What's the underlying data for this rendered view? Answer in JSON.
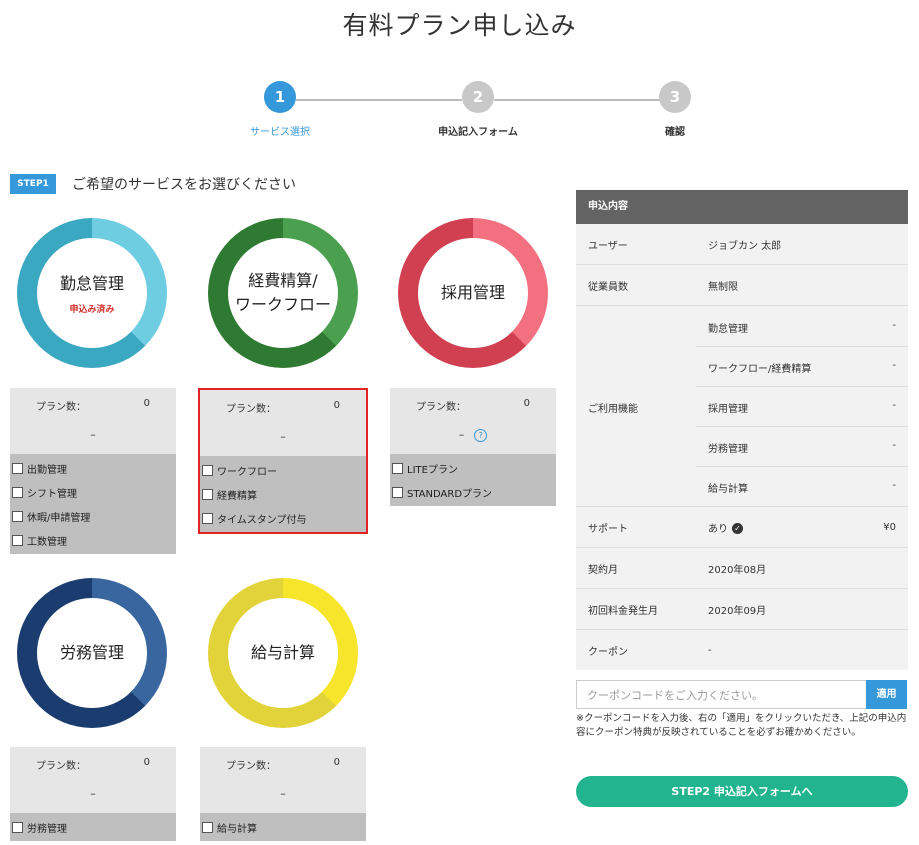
{
  "page_title": "有料プラン申し込み",
  "stepper": [
    {
      "num": "1",
      "label": "サービス選択",
      "active": true
    },
    {
      "num": "2",
      "label": "申込記入フォーム",
      "active": false
    },
    {
      "num": "3",
      "label": "確認",
      "active": false
    }
  ],
  "step1": {
    "badge": "STEP1",
    "heading": "ご希望のサービスをお選びください"
  },
  "services": [
    {
      "name_line1": "勤怠管理",
      "name_line2": "",
      "sub": "申込み済み",
      "color_main": "#3aa8c1",
      "color_light": "#6fcde2",
      "plan_label": "プラン数：",
      "plan_count": "0",
      "dash": "–",
      "items": [
        "出勤管理",
        "シフト管理",
        "休暇/申請管理",
        "工数管理"
      ]
    },
    {
      "name_line1": "経費精算/",
      "name_line2": "ワークフロー",
      "sub": "",
      "color_main": "#2f7a32",
      "color_light": "#4aa04e",
      "plan_label": "プラン数：",
      "plan_count": "0",
      "dash": "–",
      "items": [
        "ワークフロー",
        "経費精算",
        "タイムスタンプ付与"
      ]
    },
    {
      "name_line1": "採用管理",
      "name_line2": "",
      "sub": "",
      "color_main": "#d04050",
      "color_light": "#f27080",
      "plan_label": "プラン数：",
      "plan_count": "0",
      "dash": "–",
      "help_icon": "?",
      "items": [
        "LITEプラン",
        "STANDARDプラン"
      ]
    },
    {
      "name_line1": "労務管理",
      "name_line2": "",
      "sub": "",
      "color_main": "#1a3c6e",
      "color_light": "#3a66a0",
      "plan_label": "プラン数：",
      "plan_count": "0",
      "dash": "–",
      "items": [
        "労務管理"
      ]
    },
    {
      "name_line1": "給与計算",
      "name_line2": "",
      "sub": "",
      "color_main": "#e2d33a",
      "color_light": "#f6e52a",
      "plan_label": "プラン数：",
      "plan_count": "0",
      "dash": "–",
      "items": [
        "給与計算"
      ]
    }
  ],
  "summary": {
    "header": "申込内容",
    "user_key": "ユーザー",
    "user_val": "ジョブカン 太郎",
    "emp_key": "従業員数",
    "emp_val": "無制限",
    "features_key": "ご利用機能",
    "features": [
      {
        "name": "勤怠管理",
        "val": "-"
      },
      {
        "name": "ワークフロー/経費精算",
        "val": "-"
      },
      {
        "name": "採用管理",
        "val": "-"
      },
      {
        "name": "労務管理",
        "val": "-"
      },
      {
        "name": "給与計算",
        "val": "-"
      }
    ],
    "support_key": "サポート",
    "support_val": "あり",
    "support_price": "¥0",
    "contract_key": "契約月",
    "contract_val": "2020年08月",
    "first_fee_key": "初回料金発生月",
    "first_fee_val": "2020年09月",
    "coupon_key": "クーポン",
    "coupon_val": "-"
  },
  "coupon": {
    "placeholder": "クーポンコードをご入力ください。",
    "apply": "適用",
    "note": "※クーポンコードを入力後、右の「適用」をクリックいただき、上記の申込内容にクーポン特典が反映されていることを必ずお確かめください。"
  },
  "next_button": "STEP2 申込記入フォームへ"
}
